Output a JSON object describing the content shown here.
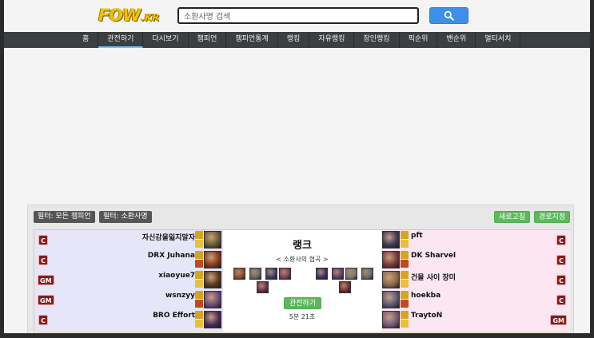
{
  "header": {
    "logo_main": "FOW",
    "logo_suffix": ".KR",
    "search_value": "소환사명 검색"
  },
  "nav": {
    "items": [
      "홈",
      "관전하기",
      "다시보기",
      "챔피언",
      "챔피언통계",
      "랭킹",
      "자유랭킹",
      "장인랭킹",
      "픽순위",
      "밴순위",
      "멀티서치"
    ],
    "active_index": 1
  },
  "panel": {
    "filter_champion": "필터: 모든 챔피언",
    "filter_summoner": "필터: 소환사명",
    "refresh": "새로고침",
    "route": "경로지정"
  },
  "match": {
    "mode": "랭크",
    "map": "< 소환사의 협곡 >",
    "watch": "관전하기",
    "duration": "5분 21초",
    "blue_team": [
      {
        "name": "자신감을잃지말자",
        "tier": "C",
        "color": "#6b5a30"
      },
      {
        "name": "DRX Juhana",
        "tier": "C",
        "color": "#8a3a1a"
      },
      {
        "name": "xiaoyue7",
        "tier": "GM",
        "color": "#5a3a20"
      },
      {
        "name": "wsnzyy",
        "tier": "GM",
        "color": "#6a4a7a"
      },
      {
        "name": "BRO Effort",
        "tier": "C",
        "color": "#4a2a5a"
      }
    ],
    "red_team": [
      {
        "name": "pft",
        "tier": "C",
        "color": "#3a3a5a"
      },
      {
        "name": "DK Sharvel",
        "tier": "C",
        "color": "#7a3a3a"
      },
      {
        "name": "건물 사이 장미",
        "tier": "C",
        "color": "#8a6a4a"
      },
      {
        "name": "hoekba",
        "tier": "C",
        "color": "#5a5a7a"
      },
      {
        "name": "TraytoN",
        "tier": "GM",
        "color": "#7a5a7a"
      }
    ],
    "blue_bans": [
      "#8a4a2a",
      "#666666",
      "#3a3a6a",
      "#7a3a5a",
      "#6a2a4a"
    ],
    "red_bans": [
      "#3a2a6a",
      "#5a3a6a",
      "#777777",
      "#666666",
      "#6a2a2a",
      "#b07a4a"
    ]
  }
}
